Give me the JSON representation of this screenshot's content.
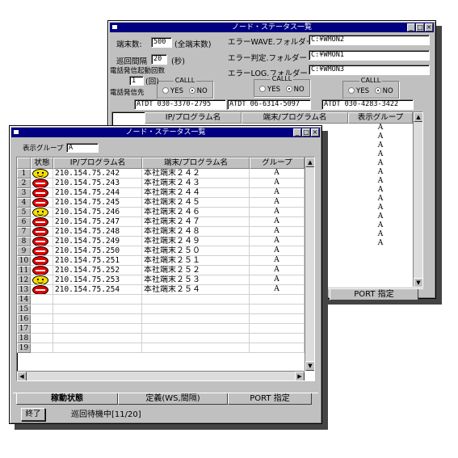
{
  "back_window": {
    "title": "ノード・ステータス一覧",
    "terminal_count_label": "端末数:",
    "terminal_count_value": "500",
    "terminal_count_suffix": "(全端末数)",
    "interval_label": "巡回間隔",
    "interval_value": "20",
    "interval_unit": "(秒)",
    "call_start_label": "電話発信起動回数",
    "call_start_value": "1",
    "call_start_unit": "(回)",
    "call_dest_label": "電話発信先",
    "wave_folder_label": "エラーWAVE.フォルダー",
    "wave_folder_value": "C:¥WMON2",
    "judge_folder_label": "エラー判定.フォルダー",
    "judge_folder_value": "C:¥WMON1",
    "log_folder_label": "エラーLOG.フォルダー",
    "log_folder_value": "C:¥WMON3",
    "call_groups": [
      {
        "caption": "CALLL",
        "yes": "YES",
        "no": "NO"
      },
      {
        "caption": "CALLL",
        "yes": "YES",
        "no": "NO"
      },
      {
        "caption": "CALLL",
        "yes": "YES",
        "no": "NO"
      }
    ],
    "phone_numbers": [
      "ATDT 030-3370-2795",
      "ATDT 06-6314-5097",
      "ATDT 030-4283-3422"
    ],
    "columns": [
      "IP/プログラム名",
      "端末/プログラム名",
      "表示グループ"
    ],
    "group_values": [
      "A",
      "A",
      "A",
      "A",
      "A",
      "A",
      "A",
      "A",
      "A",
      "A",
      "A",
      "A",
      "A",
      "A"
    ],
    "tab_port": "PORT 指定"
  },
  "front_window": {
    "title": "ノード・ステータス一覧",
    "display_group_label": "表示グループ",
    "display_group_value": "A",
    "columns": [
      "状態",
      "IP/プログラム名",
      "端末/プログラム名",
      "グループ"
    ],
    "rows": [
      {
        "n": "1",
        "status": "ok",
        "ip": "210.154.75.242",
        "name": "本社端末２４２",
        "group": "A"
      },
      {
        "n": "2",
        "status": "ng",
        "ip": "210.154.75.243",
        "name": "本社端末２４３",
        "group": "A"
      },
      {
        "n": "3",
        "status": "ng",
        "ip": "210.154.75.244",
        "name": "本社端末２４４",
        "group": "A"
      },
      {
        "n": "4",
        "status": "ng",
        "ip": "210.154.75.245",
        "name": "本社端末２４５",
        "group": "A"
      },
      {
        "n": "5",
        "status": "ok",
        "ip": "210.154.75.246",
        "name": "本社端末２４６",
        "group": "A"
      },
      {
        "n": "6",
        "status": "ng",
        "ip": "210.154.75.247",
        "name": "本社端末２４７",
        "group": "A"
      },
      {
        "n": "7",
        "status": "ng",
        "ip": "210.154.75.248",
        "name": "本社端末２４８",
        "group": "A"
      },
      {
        "n": "8",
        "status": "ng",
        "ip": "210.154.75.249",
        "name": "本社端末２４９",
        "group": "A"
      },
      {
        "n": "9",
        "status": "ng",
        "ip": "210.154.75.250",
        "name": "本社端末２５０",
        "group": "A"
      },
      {
        "n": "10",
        "status": "ng",
        "ip": "210.154.75.251",
        "name": "本社端末２５１",
        "group": "A"
      },
      {
        "n": "11",
        "status": "ng",
        "ip": "210.154.75.252",
        "name": "本社端末２５２",
        "group": "A"
      },
      {
        "n": "12",
        "status": "ok",
        "ip": "210.154.75.253",
        "name": "本社端末２５３",
        "group": "A"
      },
      {
        "n": "13",
        "status": "ng",
        "ip": "210.154.75.254",
        "name": "本社端末２５４",
        "group": "A"
      },
      {
        "n": "14",
        "status": "",
        "ip": "",
        "name": "",
        "group": ""
      },
      {
        "n": "15",
        "status": "",
        "ip": "",
        "name": "",
        "group": ""
      },
      {
        "n": "16",
        "status": "",
        "ip": "",
        "name": "",
        "group": ""
      },
      {
        "n": "17",
        "status": "",
        "ip": "",
        "name": "",
        "group": ""
      },
      {
        "n": "18",
        "status": "",
        "ip": "",
        "name": "",
        "group": ""
      },
      {
        "n": "19",
        "status": "",
        "ip": "",
        "name": "",
        "group": ""
      }
    ],
    "tabs": [
      "稼動状態",
      "定義(WS,間隔)",
      "PORT 指定"
    ],
    "exit_button": "終了",
    "status_text": "巡回待機中[11/20]"
  },
  "icons": {
    "ok": "smiley-face-icon",
    "ng": "red-stop-icon"
  },
  "colors": {
    "titlebar": "#000080",
    "face": "#c0c0c0",
    "ok": "#f5e000",
    "ng": "#e00000"
  }
}
